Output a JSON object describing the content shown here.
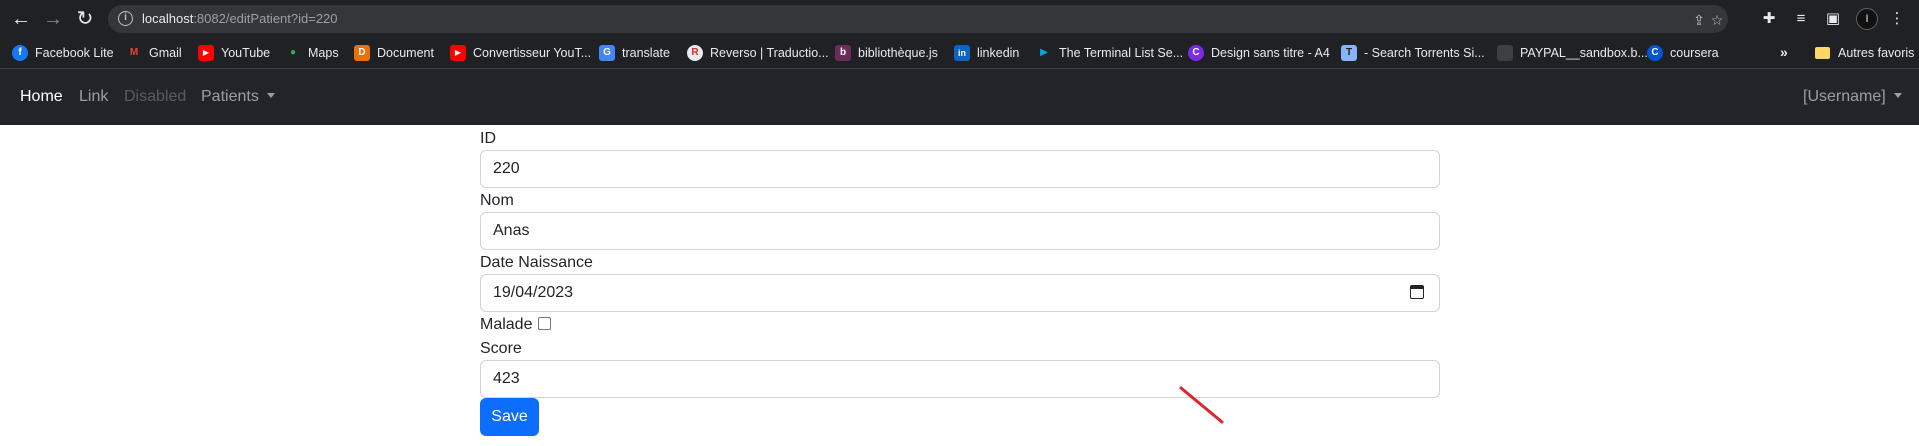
{
  "browser": {
    "url_host": "localhost",
    "url_rest": ":8082/editPatient?id=220",
    "profile_initial": "I"
  },
  "bookmarks": [
    {
      "label": "Facebook Lite",
      "icon": "facebook-icon",
      "color": "#1877f2",
      "glyph": "f"
    },
    {
      "label": "Gmail",
      "icon": "gmail-icon",
      "color": "#ea4335",
      "glyph": "M"
    },
    {
      "label": "YouTube",
      "icon": "youtube-icon",
      "color": "#ff0000",
      "glyph": "▶"
    },
    {
      "label": "Maps",
      "icon": "maps-icon",
      "color": "#34a853",
      "glyph": "●"
    },
    {
      "label": "Document",
      "icon": "document-icon",
      "color": "#e8710a",
      "glyph": "D"
    },
    {
      "label": "Convertisseur YouT...",
      "icon": "youtube-icon",
      "color": "#ff0000",
      "glyph": "▶"
    },
    {
      "label": "translate",
      "icon": "translate-icon",
      "color": "#4285f4",
      "glyph": "G"
    },
    {
      "label": "Reverso | Traductio...",
      "icon": "reverso-icon",
      "color": "#e8eaed",
      "glyph": "R"
    },
    {
      "label": "bibliothèque.js",
      "icon": "library-icon",
      "color": "#6b2d5c",
      "glyph": "b"
    },
    {
      "label": "linkedin",
      "icon": "linkedin-icon",
      "color": "#0a66c2",
      "glyph": "in"
    },
    {
      "label": "The Terminal List Se...",
      "icon": "prime-icon",
      "color": "#00a8e1",
      "glyph": "▶"
    },
    {
      "label": "Design sans titre - A4",
      "icon": "canva-icon",
      "color": "#7d2ae8",
      "glyph": "C"
    },
    {
      "label": "- Search Torrents Si...",
      "icon": "torrent-icon",
      "color": "#8ab4f8",
      "glyph": "T"
    },
    {
      "label": "PAYPAL__sandbox.b...",
      "icon": "paypal-icon",
      "color": "#3c4043",
      "glyph": ""
    },
    {
      "label": "coursera",
      "icon": "coursera-icon",
      "color": "#0056d2",
      "glyph": "C"
    }
  ],
  "bookmarks_other": "Autres favoris",
  "navbar": {
    "home": "Home",
    "link": "Link",
    "disabled": "Disabled",
    "patients": "Patients",
    "username": "[Username]"
  },
  "form": {
    "id_label": "ID",
    "id_value": "220",
    "nom_label": "Nom",
    "nom_value": "Anas",
    "date_label": "Date Naissance",
    "date_value": "19/04/2023",
    "malade_label": "Malade",
    "malade_checked": false,
    "score_label": "Score",
    "score_value": "423",
    "save_label": "Save"
  },
  "colors": {
    "navbar_bg": "#212529",
    "primary": "#0d6efd",
    "annotation": "#e0242b"
  }
}
